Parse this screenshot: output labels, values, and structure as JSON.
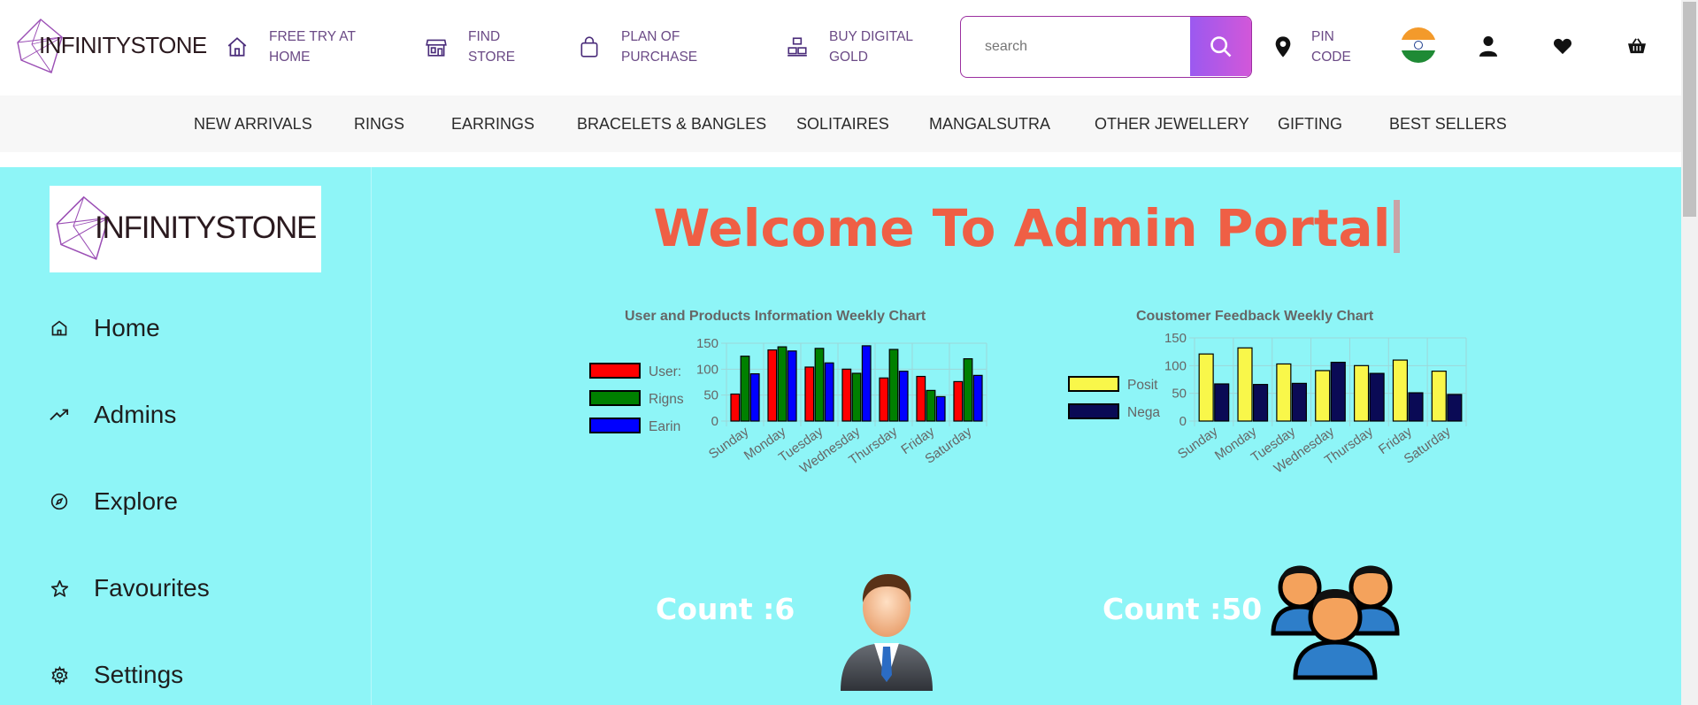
{
  "header": {
    "logo_text": "INFINITYSTONE",
    "items": [
      {
        "label_line1": "FREE TRY AT",
        "label_line2": "HOME",
        "icon": "home-icon"
      },
      {
        "label_line1": "FIND",
        "label_line2": "STORE",
        "icon": "store-icon"
      },
      {
        "label_line1": "PLAN OF",
        "label_line2": "PURCHASE",
        "icon": "shopping-bag-icon"
      },
      {
        "label_line1": "BUY DIGITAL",
        "label_line2": "GOLD",
        "icon": "gold-bars-icon"
      }
    ],
    "search": {
      "placeholder": "search",
      "value": "search"
    },
    "pin": {
      "line1": "PIN",
      "line2": "CODE"
    },
    "colors": {
      "brand_purple": "#6b4a86",
      "search_gradient_start": "#9b59f0",
      "search_gradient_end": "#d257d9"
    }
  },
  "nav": {
    "items": [
      "NEW ARRIVALS",
      "RINGS",
      "EARRINGS",
      "BRACELETS & BANGLES",
      "SOLITAIRES",
      "MANGALSUTRA",
      "OTHER JEWELLERY",
      "GIFTING",
      "BEST SELLERS"
    ]
  },
  "sidebar": {
    "logo_text": "INFINITYSTONE",
    "items": [
      {
        "label": "Home",
        "icon": "home-outline-icon"
      },
      {
        "label": "Admins",
        "icon": "trending-up-icon"
      },
      {
        "label": "Explore",
        "icon": "compass-icon"
      },
      {
        "label": "Favourites",
        "icon": "star-outline-icon"
      },
      {
        "label": "Settings",
        "icon": "gear-icon"
      }
    ]
  },
  "main": {
    "title": "Welcome To Admin Portal",
    "title_color": "#ef5f45",
    "background": "#8ef5f7"
  },
  "cards": [
    {
      "count_text": "Count :6",
      "color": "#170b55",
      "icon": "admin-user-icon"
    },
    {
      "count_text": "Count :50",
      "color": "#58c6b6",
      "icon": "users-group-icon"
    }
  ],
  "chart_data": [
    {
      "type": "bar",
      "title": "User and Products Information Weekly Chart",
      "categories": [
        "Sunday",
        "Monday",
        "Tuesday",
        "Wednesday",
        "Thursday",
        "Friday",
        "Saturday"
      ],
      "series": [
        {
          "name": "Users",
          "legend_text": "User:",
          "color": "#ff0000",
          "values": [
            52,
            137,
            104,
            100,
            83,
            86,
            76
          ]
        },
        {
          "name": "Rigns",
          "legend_text": "Rigns",
          "color": "#008000",
          "values": [
            125,
            143,
            140,
            92,
            138,
            59,
            120
          ]
        },
        {
          "name": "Earings",
          "legend_text": "Earin",
          "color": "#0000ff",
          "values": [
            91,
            135,
            112,
            145,
            96,
            47,
            88
          ]
        }
      ],
      "yticks": [
        0,
        50,
        100,
        150
      ],
      "ylim": [
        0,
        150
      ],
      "legend_position": "left"
    },
    {
      "type": "bar",
      "title": "Coustomer Feedback Weekly Chart",
      "categories": [
        "Sunday",
        "Monday",
        "Tuesday",
        "Wednesday",
        "Thursday",
        "Friday",
        "Saturday"
      ],
      "series": [
        {
          "name": "Positive",
          "legend_text": "Posit",
          "color": "#f9f74a",
          "values": [
            121,
            132,
            103,
            91,
            100,
            110,
            90
          ]
        },
        {
          "name": "Negative",
          "legend_text": "Nega",
          "color": "#0a0a55",
          "values": [
            67,
            66,
            68,
            106,
            86,
            51,
            48
          ]
        }
      ],
      "yticks": [
        0,
        50,
        100,
        150
      ],
      "ylim": [
        0,
        150
      ],
      "legend_position": "left"
    }
  ]
}
